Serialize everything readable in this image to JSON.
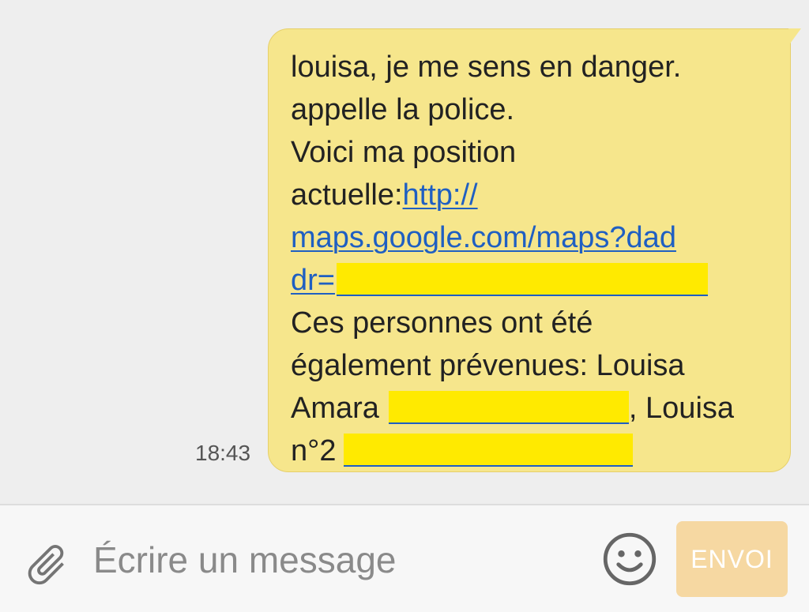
{
  "message": {
    "lines": [
      "louisa, je me sens en danger.",
      "appelle la police.",
      "Voici ma position",
      "actuelle:",
      "Ces personnes ont été",
      "également prévenues: Louisa",
      "Amara",
      ", Louisa",
      "n°2"
    ],
    "link_part1": "http://",
    "link_part2": "maps.google.com/maps?dad",
    "link_part3": "dr=",
    "timestamp": "18:43"
  },
  "composer": {
    "placeholder": "Écrire un message",
    "send_label": "ENVOI",
    "attach_icon": "paperclip-icon",
    "emoji_icon": "smiley-icon"
  },
  "colors": {
    "bubble": "#f6e68c",
    "link": "#1f5fc2",
    "redaction": "#ffea00",
    "send_button": "#f6d8a2"
  }
}
